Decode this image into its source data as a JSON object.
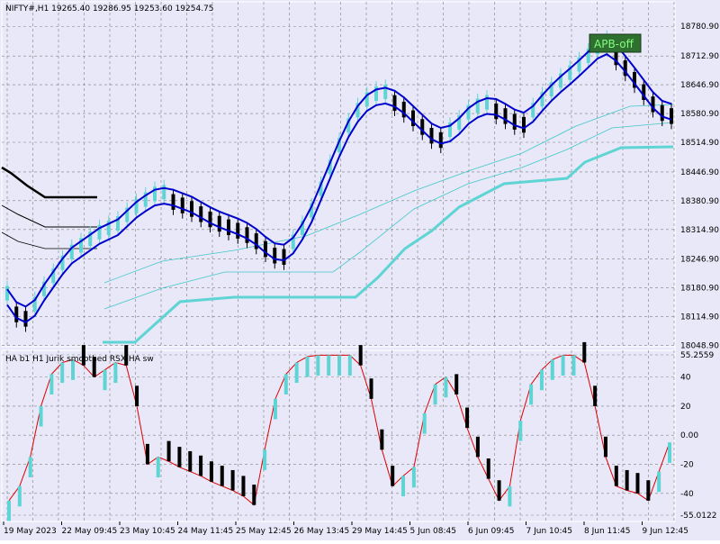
{
  "window": {
    "symbol_header": "NIFTY#,H1  19265.40 19286.95 19253.60 19254.75",
    "badge_label": "APB-off"
  },
  "colors": {
    "background": "#e8e8f8",
    "frame": "#ffffff",
    "grid": "#7f7f7f",
    "bull": "#5fd4d4",
    "bear": "#000000",
    "band": "#0000cc",
    "ma_thin": "#40c8c8",
    "ma_thick": "#5fd4d4",
    "channel": "#000000",
    "rsx_line": "#dd0000",
    "badge_bg": "#2f6f2f",
    "badge_text": "#80ff80"
  },
  "chart_data": [
    {
      "type": "candlestick",
      "title": "NIFTY#,H1  19265.40 19286.95 19253.60 19254.75",
      "ylim": [
        18050,
        18800
      ],
      "yticks": [
        "18780.90",
        "18712.90",
        "18646.90",
        "18580.90",
        "18514.90",
        "18446.90",
        "18380.90",
        "18314.90",
        "18246.90",
        "18180.90",
        "18114.90",
        "18048.90"
      ],
      "xticks": [
        "19 May 2023",
        "22 May 09:45",
        "23 May 10:45",
        "24 May 11:45",
        "25 May 12:45",
        "26 May 13:45",
        "29 May 14:45",
        "5 Jun 08:45",
        "6 Jun 09:45",
        "7 Jun 10:45",
        "8 Jun 11:45",
        "9 Jun 12:45"
      ],
      "last_bar": {
        "open": 19265.4,
        "high": 19286.95,
        "low": 19253.6,
        "close": 19254.75
      },
      "bands_center": [
        18160,
        18130,
        18120,
        18135,
        18170,
        18200,
        18230,
        18255,
        18270,
        18285,
        18300,
        18310,
        18320,
        18340,
        18360,
        18375,
        18388,
        18392,
        18388,
        18380,
        18372,
        18360,
        18348,
        18338,
        18330,
        18322,
        18312,
        18298,
        18280,
        18265,
        18262,
        18278,
        18310,
        18350,
        18400,
        18450,
        18500,
        18545,
        18580,
        18605,
        18618,
        18622,
        18615,
        18600,
        18580,
        18560,
        18540,
        18530,
        18535,
        18552,
        18575,
        18590,
        18598,
        18596,
        18585,
        18572,
        18565,
        18580,
        18605,
        18628,
        18648,
        18666,
        18685,
        18705,
        18725,
        18735,
        18720,
        18695,
        18668,
        18640,
        18612,
        18592,
        18585
      ]
    },
    {
      "type": "line",
      "title": "HA b1 H1 Jurik smoothed RSX HA sw",
      "ylim": [
        -55.0122,
        55.2559
      ],
      "yticks": [
        "55.2559",
        "40",
        "20",
        "0.00",
        "-20",
        "-40",
        "-55.0122"
      ],
      "rsx_values": [
        -45,
        -35,
        -15,
        20,
        42,
        50,
        52,
        48,
        40,
        45,
        50,
        48,
        20,
        -20,
        -15,
        -18,
        -22,
        -25,
        -28,
        -32,
        -35,
        -38,
        -42,
        -48,
        -10,
        25,
        42,
        50,
        54,
        55,
        55,
        55,
        55,
        48,
        25,
        -10,
        -35,
        -28,
        -22,
        15,
        35,
        40,
        28,
        5,
        -15,
        -30,
        -45,
        -35,
        10,
        35,
        45,
        52,
        55,
        55,
        50,
        20,
        -15,
        -35,
        -38,
        -40,
        -45,
        -25,
        -5
      ]
    }
  ]
}
